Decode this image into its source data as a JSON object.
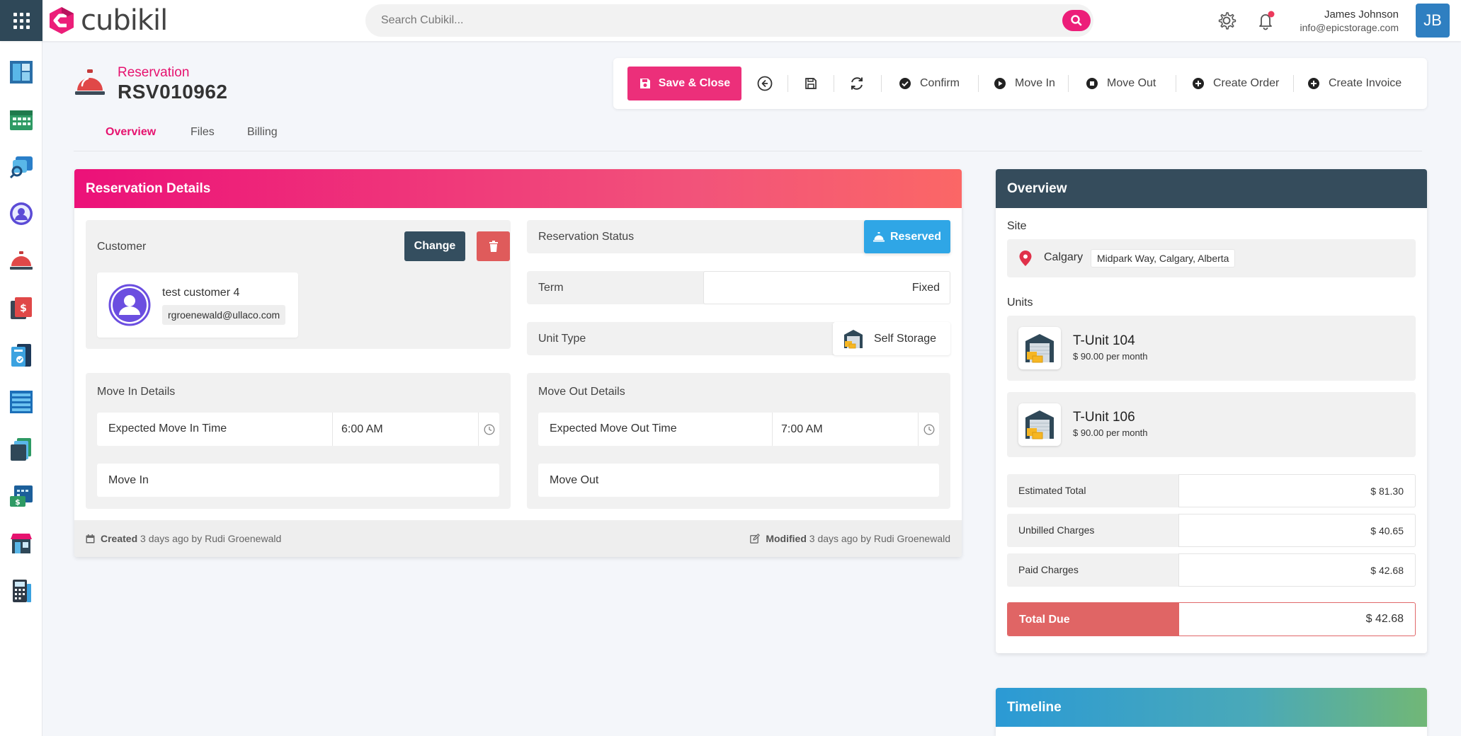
{
  "app": {
    "name": "cubikil",
    "colors": {
      "brand": "#ec1e79",
      "dark": "#2f4858",
      "accent_blue": "#2fa6e6",
      "danger": "#e06565"
    }
  },
  "search": {
    "placeholder": "Search Cubikil..."
  },
  "user": {
    "name": "James Johnson",
    "email": "info@epicstorage.com",
    "initials": "JB"
  },
  "sidebar": {
    "items": [
      {
        "icon": "dashboard-icon"
      },
      {
        "icon": "calendar-icon"
      },
      {
        "icon": "search-units-icon"
      },
      {
        "icon": "customer-icon"
      },
      {
        "icon": "reservation-bell-icon"
      },
      {
        "icon": "billing-icon"
      },
      {
        "icon": "documents-icon"
      },
      {
        "icon": "units-list-icon"
      },
      {
        "icon": "files-icon"
      },
      {
        "icon": "payments-calendar-icon"
      },
      {
        "icon": "store-icon"
      },
      {
        "icon": "calculator-icon"
      }
    ]
  },
  "header": {
    "label": "Reservation",
    "id": "RSV010962"
  },
  "toolbar": {
    "save_close": "Save & Close",
    "confirm": "Confirm",
    "move_in": "Move In",
    "move_out": "Move Out",
    "create_order": "Create Order",
    "create_invoice": "Create Invoice"
  },
  "tabs": [
    {
      "label": "Overview",
      "active": true
    },
    {
      "label": "Files",
      "active": false
    },
    {
      "label": "Billing",
      "active": false
    }
  ],
  "details": {
    "title": "Reservation Details",
    "customer": {
      "label": "Customer",
      "change_label": "Change",
      "name": "test customer 4",
      "email": "rgroenewald@ullaco.com"
    },
    "status": {
      "label": "Reservation Status",
      "value": "Reserved"
    },
    "term": {
      "label": "Term",
      "value": "Fixed"
    },
    "unit_type": {
      "label": "Unit Type",
      "value": "Self Storage"
    },
    "move_in": {
      "title": "Move In Details",
      "time_label": "Expected Move In Time",
      "time_value": "6:00 AM",
      "row_label": "Move In"
    },
    "move_out": {
      "title": "Move Out Details",
      "time_label": "Expected Move Out Time",
      "time_value": "7:00 AM",
      "row_label": "Move Out"
    },
    "footer": {
      "created_label": "Created",
      "created_text": "3 days ago by Rudi Groenewald",
      "modified_label": "Modified",
      "modified_text": "3 days ago by Rudi Groenewald"
    }
  },
  "overview": {
    "title": "Overview",
    "site_label": "Site",
    "site_name": "Calgary",
    "site_address": "Midpark Way, Calgary, Alberta",
    "units_label": "Units",
    "units": [
      {
        "name": "T-Unit 104",
        "price": "$ 90.00 per month"
      },
      {
        "name": "T-Unit 106",
        "price": "$ 90.00 per month"
      }
    ],
    "summary": [
      {
        "label": "Estimated Total",
        "value": "$ 81.30"
      },
      {
        "label": "Unbilled Charges",
        "value": "$ 40.65"
      },
      {
        "label": "Paid Charges",
        "value": "$ 42.68"
      }
    ],
    "total_due_label": "Total Due",
    "total_due_value": "$ 42.68"
  },
  "timeline": {
    "title": "Timeline"
  }
}
